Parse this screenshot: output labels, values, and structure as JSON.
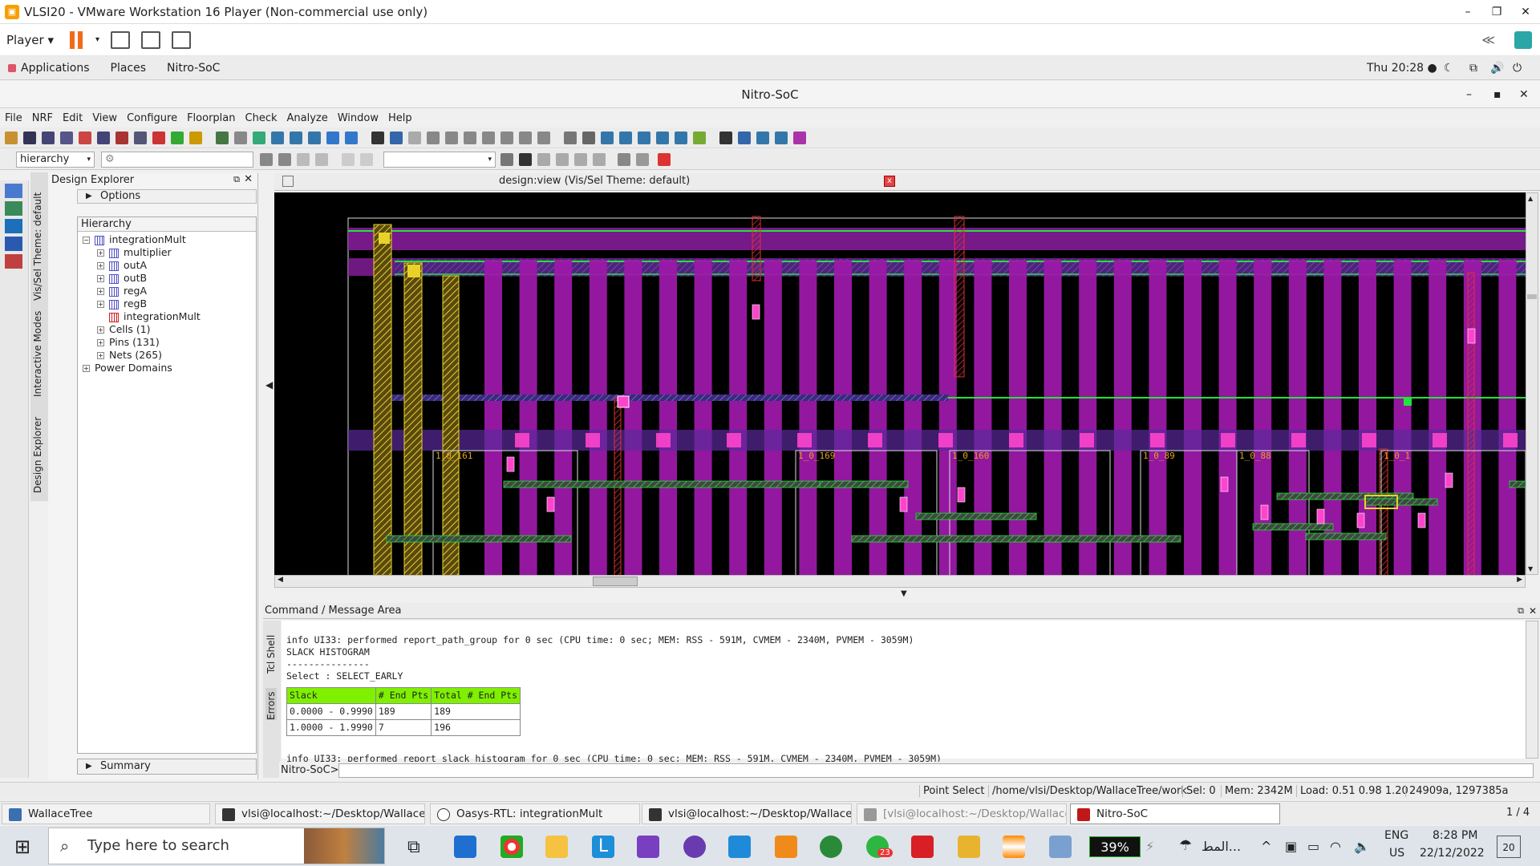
{
  "window": {
    "title": "VLSI20 - VMware Workstation 16 Player (Non-commercial use only)",
    "minimize": "–",
    "restore": "❐",
    "close": "✕"
  },
  "vmbar": {
    "player_label": "Player ▾",
    "collapse": "≪"
  },
  "gnome": {
    "applications": "Applications",
    "places": "Places",
    "app": "Nitro-SoC",
    "clock": "Thu 20:28 ●"
  },
  "app": {
    "title": "Nitro-SoC",
    "min": "–",
    "max": "▪",
    "close": "✕"
  },
  "menu": [
    "File",
    "NRF",
    "Edit",
    "View",
    "Configure",
    "Floorplan",
    "Check",
    "Analyze",
    "Window",
    "Help"
  ],
  "toolbar2": {
    "hierarchy_combo": "hierarchy"
  },
  "vtabs": {
    "theme": "Vis/Sel Theme: default",
    "modes": "Interactive Modes",
    "explorer": "Design Explorer"
  },
  "design_explorer": {
    "title": "Design Explorer",
    "options": "Options",
    "hierarchy_label": "Hierarchy",
    "root": "integrationMult",
    "children": [
      "multiplier",
      "outA",
      "outB",
      "regA",
      "regB",
      "integrationMult"
    ],
    "cells": "Cells (1)",
    "pins": "Pins (131)",
    "nets": "Nets (265)",
    "power": "Power Domains",
    "summary": "Summary"
  },
  "design_view": {
    "title": "design:view  (Vis/Sel Theme: default)",
    "close": "x",
    "labels": [
      "1_0_161",
      "1_0_169",
      "1_0_160",
      "1_0_89",
      "1_0_88",
      "1_0_1"
    ]
  },
  "command": {
    "header": "Command / Message Area",
    "tabs": {
      "tcl": "Tcl Shell",
      "errors": "Errors"
    },
    "lines": [
      "info UI33: performed report_path_group for 0 sec (CPU time: 0 sec; MEM: RSS - 591M, CVMEM - 2340M, PVMEM - 3059M)",
      "SLACK HISTOGRAM",
      "---------------",
      "Select : SELECT_EARLY"
    ],
    "table": {
      "headers": [
        "Slack",
        "# End Pts",
        "Total # End Pts"
      ],
      "rows": [
        [
          "0.0000 - 0.9990",
          "189",
          "189"
        ],
        [
          "1.0000 - 1.9990",
          "7",
          "196"
        ]
      ]
    },
    "last_line": "info UI33: performed report_slack_histogram for 0 sec (CPU time: 0 sec; MEM: RSS - 591M, CVMEM - 2340M, PVMEM - 3059M)",
    "prompt": "Nitro-SoC>"
  },
  "status": {
    "mode": "Point Select",
    "path": "/home/vlsi/Desktop/WallaceTree/work",
    "sel": "Sel: 0",
    "mem": "Mem: 2342M",
    "load": "Load: 0.51 0.98 1.20",
    "coords": "24909a, 1297385a"
  },
  "gtasks": [
    "WallaceTree",
    "vlsi@localhost:~/Desktop/WallaceTr...",
    "Oasys-RTL: integrationMult",
    "vlsi@localhost:~/Desktop/WallaceTr...",
    "[vlsi@localhost:~/Desktop/WallaceT...",
    "Nitro-SoC"
  ],
  "gpager": "1 / 4",
  "wintask": {
    "search": "Type here to search",
    "battery": "39%",
    "whatsapp_badge": "23",
    "lang": "ENG",
    "region": "US",
    "time": "8:28 PM",
    "date": "22/12/2022",
    "notif": "20",
    "arabic": "المط..."
  },
  "colors": {
    "metal_v": "#9b19a8",
    "metal_h": "#7a2a9a",
    "green": "#22e33a",
    "yellow": "#e8d22a",
    "pink": "#ff44cc"
  }
}
